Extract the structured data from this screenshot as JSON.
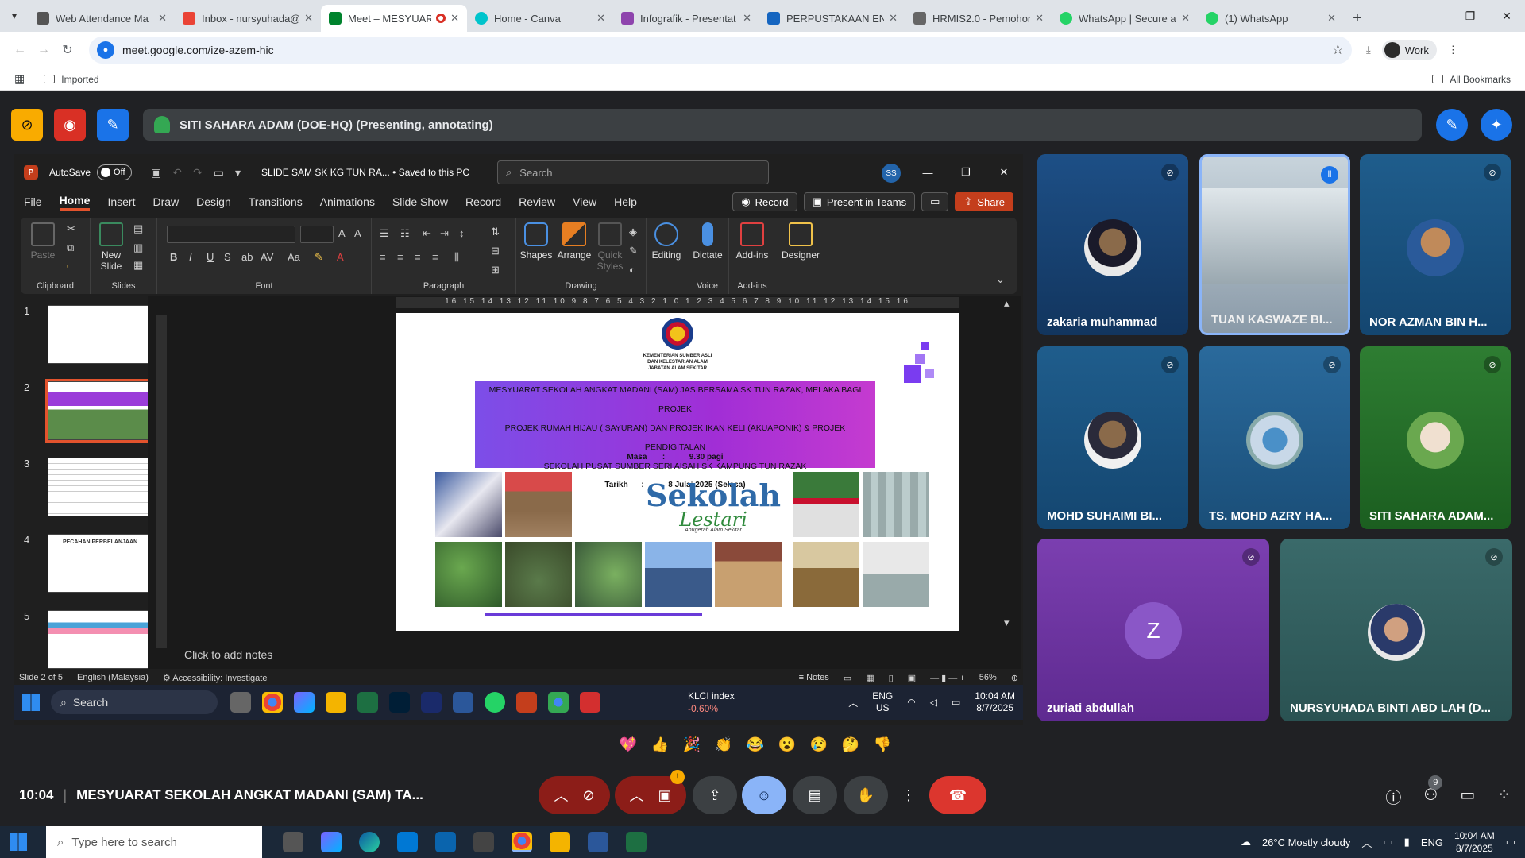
{
  "browser": {
    "tabs": [
      {
        "title": "Web Attendance Ma",
        "color": "#555"
      },
      {
        "title": "Inbox - nursyuhada@",
        "color": "#ea4335"
      },
      {
        "title": "Meet – MESYUAR",
        "color": "#00832d",
        "active": true
      },
      {
        "title": "Home - Canva",
        "color": "#00c4cc"
      },
      {
        "title": "Infografik - Presentat",
        "color": "#8e44ad"
      },
      {
        "title": "PERPUSTAKAAN ENV",
        "color": "#1565c0"
      },
      {
        "title": "HRMIS2.0 - Pemohon",
        "color": "#666"
      },
      {
        "title": "WhatsApp | Secure a",
        "color": "#25d366"
      },
      {
        "title": "(1) WhatsApp",
        "color": "#25d366"
      }
    ],
    "url": "meet.google.com/ize-azem-hic",
    "profile": "Work",
    "bookmark_imported": "Imported",
    "bookmark_all": "All Bookmarks"
  },
  "meet": {
    "presenting_label": "SITI SAHARA ADAM (DOE-HQ) (Presenting, annotating)",
    "time": "10:04",
    "meeting_title": "MESYUARAT SEKOLAH ANGKAT MADANI (SAM) TA...",
    "people_count": "9",
    "participants": [
      {
        "name": "zakaria muhammad"
      },
      {
        "name": "TUAN KASWAZE BI..."
      },
      {
        "name": "NOR AZMAN BIN H..."
      },
      {
        "name": "MOHD SUHAIMI BI..."
      },
      {
        "name": "TS. MOHD AZRY HA..."
      },
      {
        "name": "SITI SAHARA ADAM..."
      },
      {
        "name": "zuriati abdullah",
        "initial": "Z"
      },
      {
        "name": "NURSYUHADA BINTI ABD LAH (D..."
      }
    ],
    "reactions": [
      "💖",
      "👍",
      "🎉",
      "👏",
      "😂",
      "😮",
      "😢",
      "🤔",
      "👎"
    ]
  },
  "ppt": {
    "autosave": "AutoSave",
    "autosave_state": "Off",
    "doc_title": "SLIDE SAM SK KG TUN RA... • Saved to this PC",
    "search_placeholder": "Search",
    "avatar_initials": "SS",
    "menu": [
      "File",
      "Home",
      "Insert",
      "Draw",
      "Design",
      "Transitions",
      "Animations",
      "Slide Show",
      "Record",
      "Review",
      "View",
      "Help"
    ],
    "record_btn": "Record",
    "present_teams": "Present in Teams",
    "share": "Share",
    "ribbon_groups": {
      "clipboard": "Clipboard",
      "slides": "Slides",
      "font": "Font",
      "paragraph": "Paragraph",
      "drawing": "Drawing",
      "voice": "Voice",
      "addins": "Add-ins"
    },
    "ribbon_buttons": {
      "paste": "Paste",
      "new_slide": "New Slide",
      "shapes": "Shapes",
      "arrange": "Arrange",
      "quick_styles": "Quick Styles",
      "editing": "Editing",
      "dictate": "Dictate",
      "addins": "Add-ins",
      "designer": "Designer"
    },
    "slide_numbers": [
      "1",
      "2",
      "3",
      "4",
      "5"
    ],
    "thumb4_title": "PECAHAN PERBELANJAAN",
    "ruler": "16 15 14 13 12 11 10 9 8 7 6 5 4 3 2 1 0 1 2 3 4 5 6 7 8 9 10 11 12 13 14 15 16",
    "notes_placeholder": "Click to add notes",
    "status_slide": "Slide 2 of 5",
    "status_lang": "English (Malaysia)",
    "status_access": "Accessibility: Investigate",
    "status_notes": "Notes",
    "zoom": "56%"
  },
  "slide": {
    "ministry_lines": [
      "KEMENTERIAN SUMBER ASLI",
      "DAN KELESTARIAN ALAM",
      "JABATAN ALAM SEKITAR"
    ],
    "banner_line1": "MESYUARAT SEKOLAH ANGKAT MADANI (SAM) JAS BERSAMA SK TUN RAZAK, MELAKA BAGI PROJEK",
    "banner_line2": "PROJEK RUMAH HIJAU ( SAYURAN) DAN PROJEK IKAN KELI (AKUAPONIK) & PROJEK PENDIGITALAN",
    "banner_line3": "SEKOLAH PUSAT SUMBER SERI AISAH SK KAMPUNG TUN RAZAK",
    "date_label": "Tarikh",
    "date_sep": ":",
    "date_value": "8 Julai 2025 (Selasa)",
    "time_label": "Masa",
    "time_sep": ":",
    "time_value": "9.30 pagi",
    "logo_big": "Sekolah",
    "logo_small": "Lestari",
    "logo_sub": "Anugerah Alam Sekitar"
  },
  "shared_taskbar": {
    "search": "Search",
    "klci_label": "KLCI index",
    "klci_value": "-0.60%",
    "lang": "ENG",
    "lang2": "US",
    "time": "10:04 AM",
    "date": "8/7/2025"
  },
  "os_taskbar": {
    "search_placeholder": "Type here to search",
    "weather": "26°C  Mostly cloudy",
    "lang": "ENG",
    "time": "10:04 AM",
    "date": "8/7/2025"
  }
}
